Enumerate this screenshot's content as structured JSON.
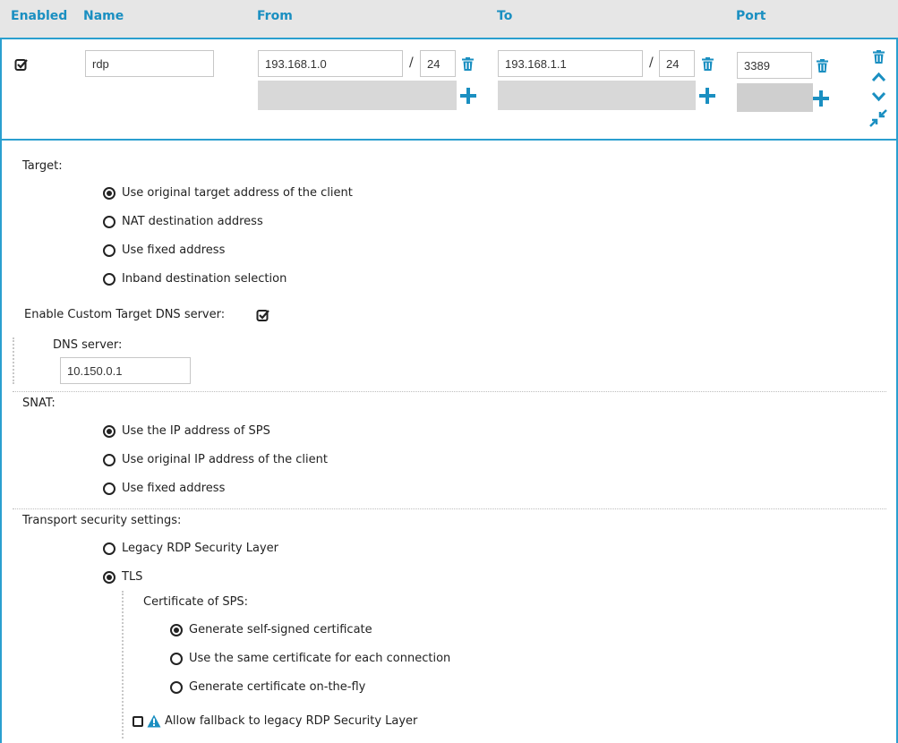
{
  "columns": {
    "enabled": "Enabled",
    "name": "Name",
    "from": "From",
    "to": "To",
    "port": "Port"
  },
  "row": {
    "name": "rdp",
    "from_ip": "193.168.1.0",
    "from_mask": "24",
    "to_ip": "193.168.1.1",
    "to_mask": "24",
    "port": "3389",
    "slash": "/"
  },
  "target": {
    "label": "Target:",
    "options": [
      "Use original target address of the client",
      "NAT destination address",
      "Use fixed address",
      "Inband destination selection"
    ],
    "selected": 0
  },
  "dns": {
    "enable_label": "Enable Custom Target DNS server:",
    "server_label": "DNS server:",
    "server_value": "10.150.0.1"
  },
  "snat": {
    "label": "SNAT:",
    "options": [
      "Use the IP address of SPS",
      "Use original IP address of the client",
      "Use fixed address"
    ],
    "selected": 0
  },
  "transport": {
    "label": "Transport security settings:",
    "options": [
      "Legacy RDP Security Layer",
      "TLS"
    ],
    "selected": 1,
    "certificate_label": "Certificate of SPS:",
    "certificate_options": [
      "Generate self-signed certificate",
      "Use the same certificate for each connection",
      "Generate certificate on-the-fly"
    ],
    "certificate_selected": 0,
    "fallback_label": "Allow fallback to legacy RDP Security Layer"
  },
  "colors": {
    "accent": "#1a8fc1",
    "border": "#2a9fcf",
    "header_bg": "#e6e6e6",
    "warning": "#1a8fc1"
  }
}
